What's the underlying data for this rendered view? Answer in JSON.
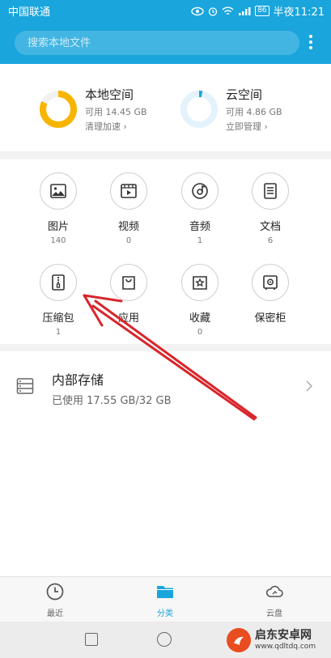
{
  "status_bar": {
    "carrier": "中国联通",
    "battery": "86",
    "time": "半夜11:21"
  },
  "header": {
    "search_placeholder": "搜索本地文件",
    "more_icon": "more-vertical-icon"
  },
  "storage": {
    "local": {
      "title": "本地空间",
      "available": "可用 14.45 GB",
      "action": "清理加速",
      "used_fraction": 0.82,
      "color": "#f7b500"
    },
    "cloud": {
      "title": "云空间",
      "available": "可用 4.86 GB",
      "action": "立即管理",
      "used_fraction": 0.03,
      "color": "#1aa5dc"
    }
  },
  "categories": [
    {
      "label": "图片",
      "count": "140",
      "icon": "image-icon"
    },
    {
      "label": "视频",
      "count": "0",
      "icon": "video-icon"
    },
    {
      "label": "音频",
      "count": "1",
      "icon": "audio-icon"
    },
    {
      "label": "文档",
      "count": "6",
      "icon": "document-icon"
    },
    {
      "label": "压缩包",
      "count": "1",
      "icon": "archive-icon"
    },
    {
      "label": "应用",
      "count": "",
      "icon": "app-bag-icon"
    },
    {
      "label": "收藏",
      "count": "0",
      "icon": "favorite-star-icon"
    },
    {
      "label": "保密柜",
      "count": "",
      "icon": "safe-icon"
    }
  ],
  "internal_storage": {
    "title": "内部存储",
    "usage": "已使用 17.55 GB/32 GB"
  },
  "bottom_nav": [
    {
      "label": "最近",
      "icon": "clock-icon",
      "active": false
    },
    {
      "label": "分类",
      "icon": "folder-icon",
      "active": true
    },
    {
      "label": "云盘",
      "icon": "cloud-icon",
      "active": false
    }
  ],
  "colors": {
    "accent": "#1aa5dc",
    "annotation_arrow": "#d9252a"
  },
  "watermark": {
    "title": "启东安卓网",
    "url": "www.qdltdq.com"
  }
}
